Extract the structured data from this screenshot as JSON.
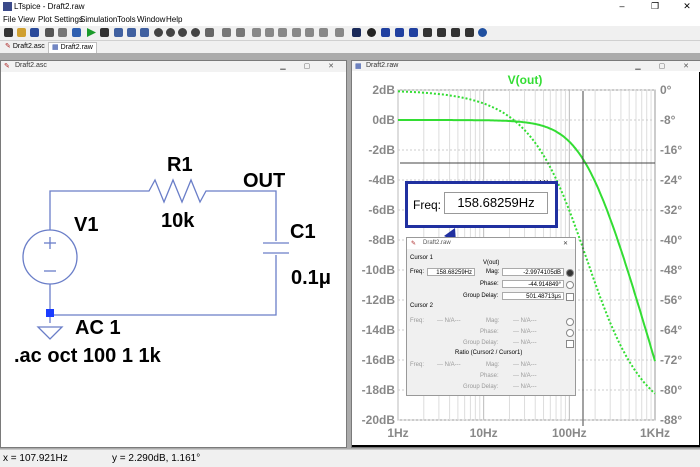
{
  "app": {
    "title": "LTspice - Draft2.raw"
  },
  "menu": [
    "File",
    "View",
    "Plot Settings",
    "Simulation",
    "Tools",
    "Window",
    "Help"
  ],
  "tabs": [
    {
      "label": "Draft2.asc"
    },
    {
      "label": "Draft2.raw"
    }
  ],
  "schematic": {
    "window_title": "Draft2.asc",
    "labels": {
      "r1": "R1",
      "r1_value": "10k",
      "c1": "C1",
      "c1_value": "0.1μ",
      "v1": "V1",
      "v1_value": "AC 1",
      "net_out": "OUT",
      "directive": ".ac oct 100 1 1k"
    },
    "wire_color": "#6a7ec8"
  },
  "plot": {
    "window_title": "Draft2.raw",
    "trace_label": "V(out)",
    "left_axis": [
      "2dB",
      "0dB",
      "-2dB",
      "-4dB",
      "-6dB",
      "-8dB",
      "-10dB",
      "-12dB",
      "-14dB",
      "-16dB",
      "-18dB",
      "-20dB"
    ],
    "right_axis": [
      "0°",
      "-8°",
      "-16°",
      "-24°",
      "-32°",
      "-40°",
      "-48°",
      "-56°",
      "-64°",
      "-72°",
      "-80°",
      "-88°"
    ],
    "x_axis": [
      "1Hz",
      "10Hz",
      "100Hz",
      "1KHz"
    ],
    "trace_color": "#33dd33",
    "cursor_label": "V(o"
  },
  "chart_data": {
    "type": "line",
    "title": "V(out)",
    "xscale": "log",
    "xlim": [
      1,
      1000
    ],
    "ylim": [
      -20,
      2
    ],
    "y2lim": [
      -88,
      0
    ],
    "grid": true,
    "series": [
      {
        "name": "V(out)",
        "axis": "left",
        "style": "solid",
        "x": [
          1,
          10,
          50,
          100,
          158.68,
          300,
          500,
          1000
        ],
        "y": [
          0,
          -0.01,
          -0.35,
          -1.12,
          -2.99,
          -6.5,
          -9.9,
          -16
        ]
      },
      {
        "name": "V(out)",
        "axis": "right",
        "style": "dotted",
        "x": [
          1,
          10,
          30,
          100,
          158.68,
          300,
          500,
          1000
        ],
        "y": [
          -0.4,
          -3.6,
          -10.7,
          -32.1,
          -44.9,
          -62.1,
          -72.3,
          -81
        ]
      }
    ]
  },
  "freq_popup": {
    "label": "Freq:",
    "value": "158.68259Hz"
  },
  "cursor_dialog": {
    "title": "Draft2.raw",
    "cursor1_title": "Cursor 1",
    "trace": "V(out)",
    "freq_label": "Freq:",
    "freq": "158.68259Hz",
    "mag_label": "Mag:",
    "mag": "-2.9974105dB",
    "phase_label": "Phase:",
    "phase": "-44.914849°",
    "gd_label": "Group Delay:",
    "gd": "501.48713μs",
    "cursor2_title": "Cursor 2",
    "na": "--- N/A---",
    "ratio_title": "Ratio (Cursor2 / Cursor1)"
  },
  "status": {
    "x": "x = 107.921Hz",
    "y": "y = 2.290dB, 1.161°"
  }
}
